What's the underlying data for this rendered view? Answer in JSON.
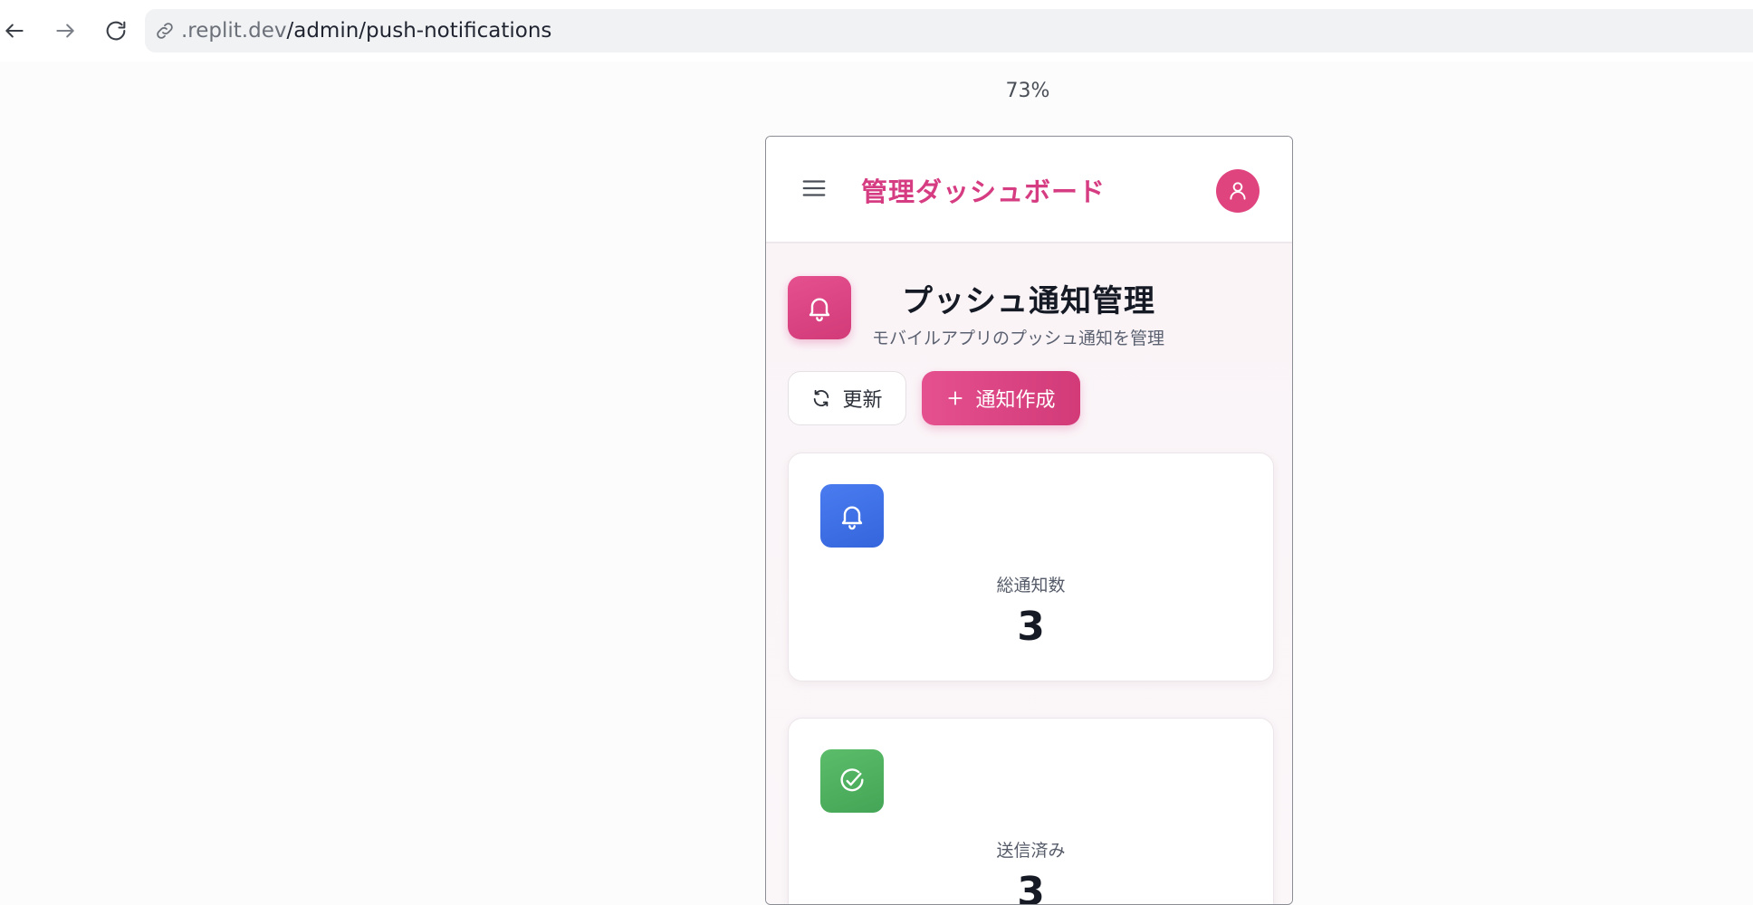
{
  "browser": {
    "url_host": ".replit.dev",
    "url_path": "/admin/push-notifications",
    "zoom": "73%",
    "icons": {
      "back": "arrow-left-icon",
      "forward": "arrow-right-icon",
      "reload": "reload-icon",
      "link": "link-icon"
    }
  },
  "header": {
    "title": "管理ダッシュボード",
    "accent_color": "#d63c82"
  },
  "page": {
    "title": "プッシュ通知管理",
    "subtitle": "モバイルアプリのプッシュ通知を管理"
  },
  "actions": {
    "refresh_label": "更新",
    "create_label": "通知作成"
  },
  "stats": [
    {
      "label": "総通知数",
      "value": "3",
      "icon": "bell-icon",
      "color": "#3f6fe6"
    },
    {
      "label": "送信済み",
      "value": "3",
      "icon": "check-circle-icon",
      "color": "#4caf5f"
    }
  ]
}
